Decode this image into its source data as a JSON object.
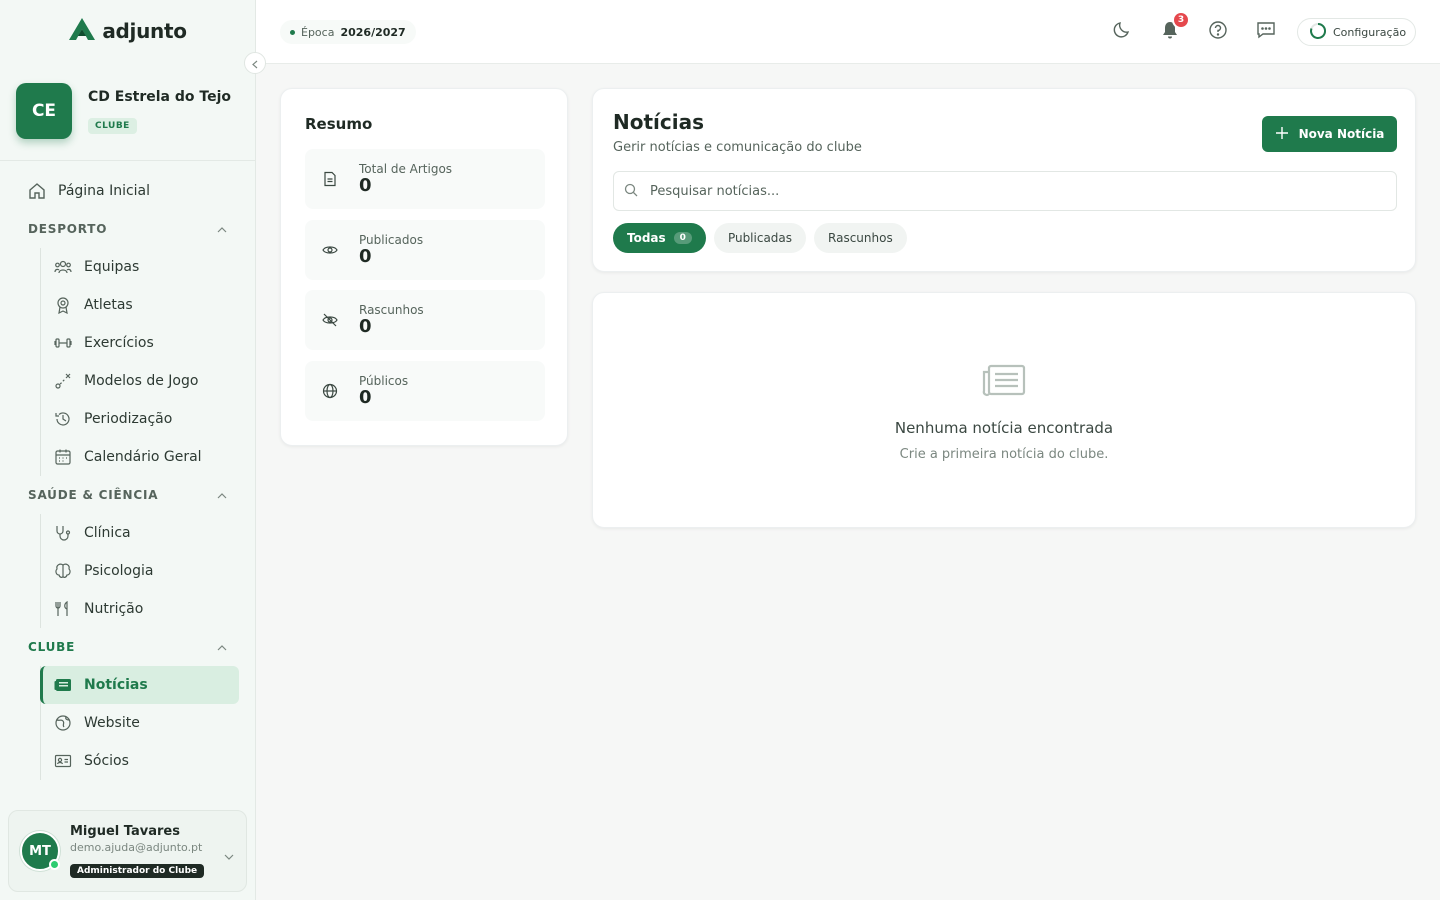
{
  "brand": {
    "name": "adjunto"
  },
  "club": {
    "initials": "CE",
    "name": "CD Estrela do Tejo",
    "badge": "CLUBE"
  },
  "nav": {
    "home": "Página Inicial",
    "sections": [
      {
        "title": "DESPORTO",
        "items": [
          "Equipas",
          "Atletas",
          "Exercícios",
          "Modelos de Jogo",
          "Periodização",
          "Calendário Geral"
        ]
      },
      {
        "title": "SAÚDE & CIÊNCIA",
        "items": [
          "Clínica",
          "Psicologia",
          "Nutrição"
        ]
      },
      {
        "title": "CLUBE",
        "items": [
          "Notícias",
          "Website",
          "Sócios"
        ]
      }
    ]
  },
  "user": {
    "initials": "MT",
    "name": "Miguel Tavares",
    "email": "demo.ajuda@adjunto.pt",
    "role": "Administrador do Clube"
  },
  "topbar": {
    "season_label": "Época",
    "season_value": "2026/2027",
    "notifications": "3",
    "config": "Configuração"
  },
  "summary": {
    "title": "Resumo",
    "stats": [
      {
        "label": "Total de Artigos",
        "value": "0",
        "icon": "document-icon"
      },
      {
        "label": "Publicados",
        "value": "0",
        "icon": "eye-icon"
      },
      {
        "label": "Rascunhos",
        "value": "0",
        "icon": "eye-off-icon"
      },
      {
        "label": "Públicos",
        "value": "0",
        "icon": "globe-icon"
      }
    ]
  },
  "news": {
    "title": "Notícias",
    "subtitle": "Gerir notícias e comunicação do clube",
    "new_button": "Nova Notícia",
    "search_placeholder": "Pesquisar notícias...",
    "filters": [
      {
        "label": "Todas",
        "count": "0"
      },
      {
        "label": "Publicadas"
      },
      {
        "label": "Rascunhos"
      }
    ]
  },
  "empty": {
    "title": "Nenhuma notícia encontrada",
    "subtitle": "Crie a primeira notícia do clube."
  },
  "colors": {
    "accent": "#1f7a4c",
    "badge": "#e5484d"
  }
}
